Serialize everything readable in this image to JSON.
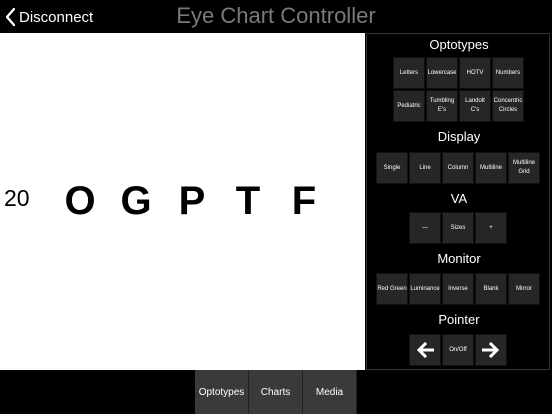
{
  "header": {
    "back_label": "Disconnect",
    "title": "Eye Chart Controller"
  },
  "chart": {
    "va": "20",
    "optotypes": [
      "O",
      "G",
      "P",
      "T",
      "F"
    ]
  },
  "panel": {
    "optotypes": {
      "title": "Optotypes",
      "buttons": [
        [
          "Letters"
        ],
        [
          "Lowercase"
        ],
        [
          "HOTV"
        ],
        [
          "Numbers"
        ],
        [
          "Pediatric"
        ],
        [
          "Tumbling",
          "E's"
        ],
        [
          "Landolt",
          "C's"
        ],
        [
          "Concentric",
          "Circles"
        ]
      ]
    },
    "display": {
      "title": "Display",
      "buttons": [
        [
          "Single"
        ],
        [
          "Line"
        ],
        [
          "Column"
        ],
        [
          "Multiline"
        ],
        [
          "Multiline",
          "Grid"
        ]
      ]
    },
    "va": {
      "title": "VA",
      "minus": "—",
      "sizes": "Sizes",
      "plus": "+"
    },
    "monitor": {
      "title": "Monitor",
      "buttons": [
        [
          "Red Green"
        ],
        [
          "Luminance"
        ],
        [
          "Inverse"
        ],
        [
          "Blank"
        ],
        [
          "Mirror"
        ]
      ]
    },
    "pointer": {
      "title": "Pointer",
      "toggle": "On/Off",
      "left_icon": "arrow-left-icon",
      "right_icon": "arrow-right-icon"
    }
  },
  "tabs": [
    "Optotypes",
    "Charts",
    "Media"
  ]
}
